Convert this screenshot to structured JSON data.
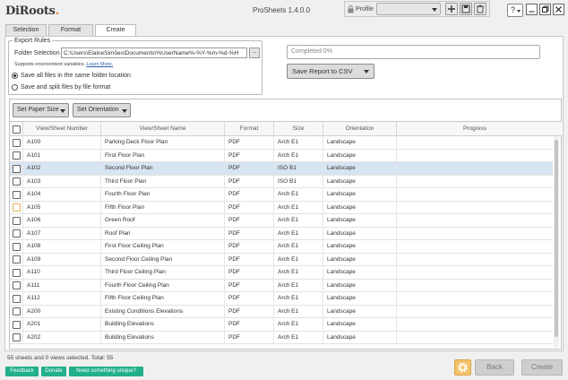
{
  "app": {
    "logo_main": "DiRoots",
    "logo_dot": ".",
    "title": "ProSheets 1.4.0.0"
  },
  "profile": {
    "label": "Profile",
    "selected_value": ""
  },
  "window_controls": {
    "help": "?"
  },
  "tabs": [
    {
      "label": "Selection",
      "active": false
    },
    {
      "label": "Format",
      "active": false
    },
    {
      "label": "Create",
      "active": true
    }
  ],
  "export_rules": {
    "legend": "Export Rules",
    "folder_label": "Folder Selection",
    "folder_value": "C:\\Users\\ElaineSimões\\Documents\\%UserName%-%Y-%m-%d-%H",
    "browse_label": "...",
    "supports_text": "Supports environment variables.",
    "learn_more": "Learn More.",
    "options": [
      {
        "label": "Save all files in the same folder location",
        "checked": true
      },
      {
        "label": "Save and split files by file format",
        "checked": false
      }
    ]
  },
  "report": {
    "progress_text": "Completed 0%",
    "progress_fraction": 0.0,
    "save_report_label": "Save Report to CSV"
  },
  "toolbar": {
    "paper_size_label": "Set Paper Size",
    "orientation_label": "Set Orientation"
  },
  "table": {
    "columns": [
      "View/Sheet Number",
      "View/Sheet Name",
      "Format",
      "Size",
      "Orientation",
      "Progress"
    ],
    "rows": [
      {
        "number": "A100",
        "name": "Parking Deck Floor Plan",
        "format": "PDF",
        "size": "Arch E1",
        "orientation": "Landscape",
        "progress": "",
        "selected": false
      },
      {
        "number": "A101",
        "name": "First Floor Plan",
        "format": "PDF",
        "size": "Arch E1",
        "orientation": "Landscape",
        "progress": "",
        "selected": false
      },
      {
        "number": "A102",
        "name": "Second Floor Plan",
        "format": "PDF",
        "size": "ISO B1",
        "orientation": "Landscape",
        "progress": "",
        "selected": true
      },
      {
        "number": "A103",
        "name": "Third Floor Plan",
        "format": "PDF",
        "size": "ISO B1",
        "orientation": "Landscape",
        "progress": "",
        "selected": false
      },
      {
        "number": "A104",
        "name": "Fourth Floor Plan",
        "format": "PDF",
        "size": "Arch E1",
        "orientation": "Landscape",
        "progress": "",
        "selected": false
      },
      {
        "number": "A105",
        "name": "Fifth Floor Plan",
        "format": "PDF",
        "size": "Arch E1",
        "orientation": "Landscape",
        "progress": "",
        "selected": false
      },
      {
        "number": "A106",
        "name": "Green Roof",
        "format": "PDF",
        "size": "Arch E1",
        "orientation": "Landscape",
        "progress": "",
        "selected": false
      },
      {
        "number": "A107",
        "name": "Roof Plan",
        "format": "PDF",
        "size": "Arch E1",
        "orientation": "Landscape",
        "progress": "",
        "selected": false
      },
      {
        "number": "A108",
        "name": "First Floor Ceiling Plan",
        "format": "PDF",
        "size": "Arch E1",
        "orientation": "Landscape",
        "progress": "",
        "selected": false
      },
      {
        "number": "A109",
        "name": "Second Floor Ceiling Plan",
        "format": "PDF",
        "size": "Arch E1",
        "orientation": "Landscape",
        "progress": "",
        "selected": false
      },
      {
        "number": "A110",
        "name": "Third Floor Ceiling Plan",
        "format": "PDF",
        "size": "Arch E1",
        "orientation": "Landscape",
        "progress": "",
        "selected": false
      },
      {
        "number": "A111",
        "name": "Fourth Floor Ceiling Plan",
        "format": "PDF",
        "size": "Arch E1",
        "orientation": "Landscape",
        "progress": "",
        "selected": false
      },
      {
        "number": "A112",
        "name": "Fifth Floor Ceiling Plan",
        "format": "PDF",
        "size": "Arch E1",
        "orientation": "Landscape",
        "progress": "",
        "selected": false
      },
      {
        "number": "A200",
        "name": "Existing Conditions Elevations",
        "format": "PDF",
        "size": "Arch E1",
        "orientation": "Landscape",
        "progress": "",
        "selected": false
      },
      {
        "number": "A201",
        "name": "Building Elevations",
        "format": "PDF",
        "size": "Arch E1",
        "orientation": "Landscape",
        "progress": "",
        "selected": false
      },
      {
        "number": "A202",
        "name": "Building Elevations",
        "format": "PDF",
        "size": "Arch E1",
        "orientation": "Landscape",
        "progress": "",
        "selected": false
      }
    ]
  },
  "footer": {
    "status": "55 sheets and 0 views selected. Total: 55",
    "feedback_label": "Feedback",
    "donate_label": "Donate",
    "unique_label": "Need something unique?",
    "back_label": "Back",
    "create_label": "Create"
  },
  "colors": {
    "accent_green": "#21b08a",
    "logo_accent": "#e37d2c",
    "selected_row": "#d7e4f1",
    "gear_button": "#f2c36b"
  }
}
